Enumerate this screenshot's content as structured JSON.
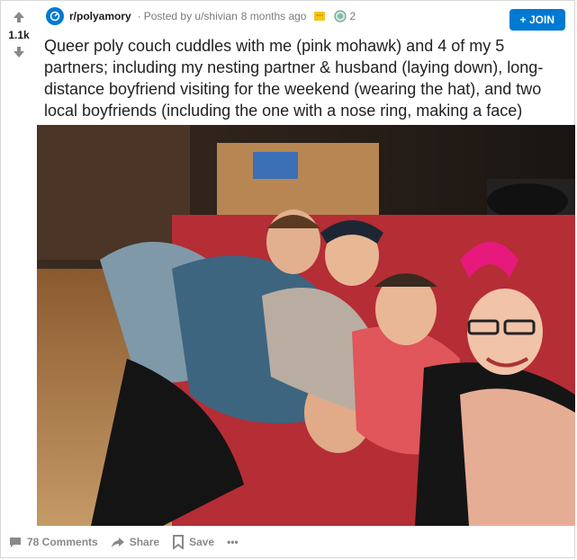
{
  "vote": {
    "score": "1.1k"
  },
  "post": {
    "subreddit": "r/polyamory",
    "posted_by": "Posted by u/shivian",
    "time": "8 months ago",
    "award_count": "2",
    "join_label": "+ JOIN",
    "title": "Queer poly couch cuddles with me (pink mohawk) and 4 of my 5 partners; including my nesting partner & husband (laying down), long-distance boyfriend visiting for the weekend (wearing the hat), and two local boyfriends (including the one with a nose ring, making a face)"
  },
  "actions": {
    "comments": "78 Comments",
    "share": "Share",
    "save": "Save",
    "more": "•••"
  },
  "colors": {
    "accent": "#0079d3",
    "upvote_gray": "#878a8c",
    "pink_mohawk": "#e8197d"
  },
  "icons": [
    "upvote-arrow-icon",
    "downvote-arrow-icon",
    "subreddit-icon",
    "gold-award-icon",
    "silver-award-icon",
    "comment-icon",
    "share-icon",
    "save-icon",
    "more-icon"
  ]
}
